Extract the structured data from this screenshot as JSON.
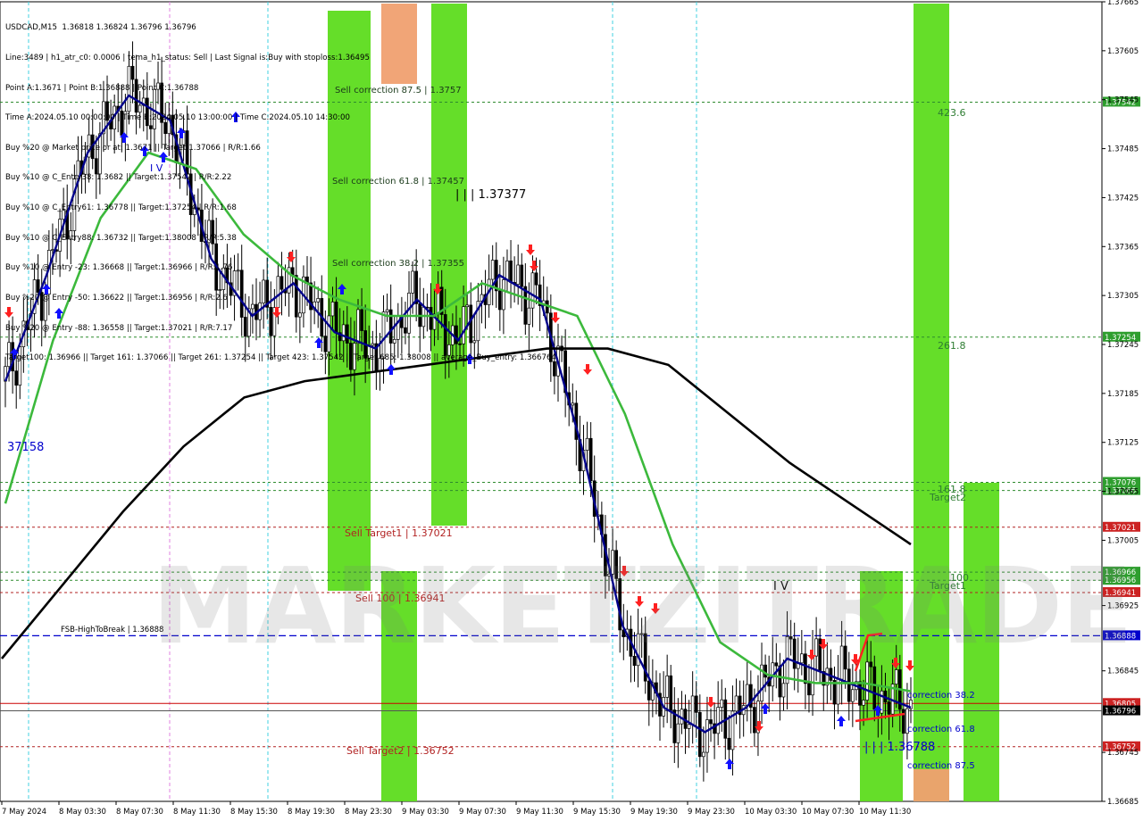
{
  "symbol_header": "USDCAD,M15  1.36818 1.36824 1.36796 1.36796",
  "info_lines": [
    "Line:3489 | h1_atr_c0: 0.0006 | tema_h1_status: Sell | Last Signal is:Buy with stoploss:1.36495",
    "Point A:1.3671 | Point B:1.36888 | Point C:1.36788",
    "Time A:2024.05.10 00:00:00 | Time B:2024.05.10 13:00:00 | Time C:2024.05.10 14:30:00",
    "Buy %20 @ Market price or at: 1.3671 || Target:1.37066 | R/R:1.66",
    "Buy %10 @ C_Entry38: 1.3682 || Target:1.37542 | R/R:2.22",
    "Buy %10 @ C_Entry61: 1.36778 || Target:1.37254 | R/R:1.68",
    "Buy %10 @ C_Entry88: 1.36732 || Target:1.38008 | R/R:5.38",
    "Buy %10 @ Entry -23: 1.36668 || Target:1.36966 | R/R:1.76",
    "Buy %20 @ Entry -50: 1.36622 || Target:1.36956 | R/R:2.6",
    "Buy %20 @ Entry -88: 1.36558 || Target:1.37021 | R/R:7.17",
    "Target100: 1.36966 || Target 161: 1.37066 || Target 261: 1.37254 || Target 423: 1.37542 || Target 685: 1.38008 || average_Buy_entry: 1.366764"
  ],
  "watermark": "MARKETZITRADE",
  "chart_data": {
    "type": "line",
    "title": "USDCAD,M15",
    "ylim": [
      1.36685,
      1.37665
    ],
    "y_ticks": [
      "1.37665",
      "1.37605",
      "1.37545",
      "1.37485",
      "1.37425",
      "1.37365",
      "1.37305",
      "1.37245",
      "1.37185",
      "1.37125",
      "1.37065",
      "1.37005",
      "1.36925",
      "1.36845",
      "1.36745",
      "1.36685"
    ],
    "x_ticks": [
      "7 May 2024",
      "8 May 03:30",
      "8 May 07:30",
      "8 May 11:30",
      "8 May 15:30",
      "8 May 19:30",
      "8 May 23:30",
      "9 May 03:30",
      "9 May 07:30",
      "9 May 11:30",
      "9 May 15:30",
      "9 May 19:30",
      "9 May 23:30",
      "10 May 03:30",
      "10 May 07:30",
      "10 May 11:30"
    ],
    "horizontal_levels": [
      {
        "price": 1.37542,
        "label": "1.37542",
        "color": "#2e8b2e",
        "style": "dotted",
        "tag_color": "#2e9e2e"
      },
      {
        "price": 1.37254,
        "label": "1.37254",
        "color": "#2e8b2e",
        "style": "dotted",
        "tag_color": "#2e9e2e"
      },
      {
        "price": 1.37076,
        "label": "1.37076",
        "color": "#2e8b2e",
        "style": "dotted",
        "tag_color": "#2e9e2e"
      },
      {
        "price": 1.37066,
        "label": "1.37066",
        "color": "#2e8b2e",
        "style": "dotted",
        "tag_color": "#2e9e2e"
      },
      {
        "price": 1.37021,
        "label": "1.37021",
        "color": "#b22222",
        "style": "dotted",
        "tag_color": "#cc2222"
      },
      {
        "price": 1.36966,
        "label": "1.36966",
        "color": "#2e8b2e",
        "style": "dotted",
        "tag_color": "#2e9e2e"
      },
      {
        "price": 1.36956,
        "label": "1.36956",
        "color": "#2e8b2e",
        "style": "dotted",
        "tag_color": "#2e9e2e"
      },
      {
        "price": 1.36941,
        "label": "1.36941",
        "color": "#b22222",
        "style": "dotted",
        "tag_color": "#cc2222"
      },
      {
        "price": 1.36888,
        "label": "1.36888",
        "color": "#0000cc",
        "style": "dashed",
        "tag_color": "#0000cc"
      },
      {
        "price": 1.36805,
        "label": "1.36805",
        "color": "#cc0000",
        "style": "solid",
        "tag_color": "#cc2222"
      },
      {
        "price": 1.36796,
        "label": "1.36796",
        "color": "#555555",
        "style": "solid",
        "tag_color": "#000000"
      },
      {
        "price": 1.36752,
        "label": "1.36752",
        "color": "#b22222",
        "style": "dotted",
        "tag_color": "#cc2222"
      }
    ],
    "text_annotations": [
      {
        "text": "Sell correction 87.5 | 1.3757",
        "color": "#1a3a1a"
      },
      {
        "text": "Sell correction 61.8 | 1.37457",
        "color": "#1a3a1a"
      },
      {
        "text": "Sell correction 38.2 | 1.37355",
        "color": "#1a3a1a"
      },
      {
        "text": "| | | 1.37377",
        "color": "#000000"
      },
      {
        "text": "Sell Target1 | 1.37021",
        "color": "#b22222"
      },
      {
        "text": "Sell 100 | 1.36941",
        "color": "#b22222"
      },
      {
        "text": "Sell Target2 | 1.36752",
        "color": "#b22222"
      },
      {
        "text": "FSB-HighToBreak | 1.36888",
        "color": "#000000"
      },
      {
        "text": "423.6",
        "color": "#2e7d32"
      },
      {
        "text": "261.8",
        "color": "#2e7d32"
      },
      {
        "text": "161.8",
        "color": "#2e7d32"
      },
      {
        "text": "Target2",
        "color": "#2e7d32"
      },
      {
        "text": "100",
        "color": "#2e7d32"
      },
      {
        "text": "Target1",
        "color": "#2e7d32"
      },
      {
        "text": "correction 38.2",
        "color": "#0000cc"
      },
      {
        "text": "correction 61.8",
        "color": "#0000cc"
      },
      {
        "text": "correction 87.5",
        "color": "#0000cc"
      },
      {
        "text": "| | | 1.36788",
        "color": "#0000cc"
      },
      {
        "text": "I V",
        "color": "#000000"
      },
      {
        "text": "I V",
        "color": "#0000cc"
      },
      {
        "text": "37158",
        "color": "#0000cc"
      }
    ],
    "series": [
      {
        "name": "",
        "color": "#00008b",
        "values": [
          1.372,
          1.3733,
          1.3748,
          1.3755,
          1.3752,
          1.3735,
          1.3728,
          1.3732,
          1.3726,
          1.3724,
          1.373,
          1.3725,
          1.3733,
          1.373,
          1.3712,
          1.369,
          1.368,
          1.3677,
          1.368,
          1.3686,
          1.3684,
          1.3682,
          1.368
        ]
      },
      {
        "name": "",
        "color": "#3cb93c",
        "values": [
          1.3705,
          1.3725,
          1.374,
          1.3748,
          1.3746,
          1.3738,
          1.3733,
          1.373,
          1.3728,
          1.3728,
          1.3732,
          1.373,
          1.3728,
          1.3716,
          1.37,
          1.3688,
          1.3684,
          1.3683,
          1.3683,
          1.3682
        ]
      },
      {
        "name": "",
        "color": "#000000",
        "values": [
          1.3686,
          1.3695,
          1.3704,
          1.3712,
          1.3718,
          1.372,
          1.3721,
          1.3722,
          1.3723,
          1.3724,
          1.3724,
          1.3722,
          1.3716,
          1.371,
          1.3705,
          1.37
        ]
      }
    ],
    "zones": [
      {
        "name": "sell-zone-green-1",
        "color": "#5ddc1e"
      },
      {
        "name": "sell-zone-orange-1",
        "color": "#f4a460"
      },
      {
        "name": "sell-zone-green-2",
        "color": "#5ddc1e"
      },
      {
        "name": "buy-zone-green-1",
        "color": "#5ddc1e"
      },
      {
        "name": "buy-zone-green-2",
        "color": "#5ddc1e"
      },
      {
        "name": "buy-zone-orange",
        "color": "#f4a460"
      },
      {
        "name": "buy-zone-green-3",
        "color": "#5ddc1e"
      }
    ]
  }
}
